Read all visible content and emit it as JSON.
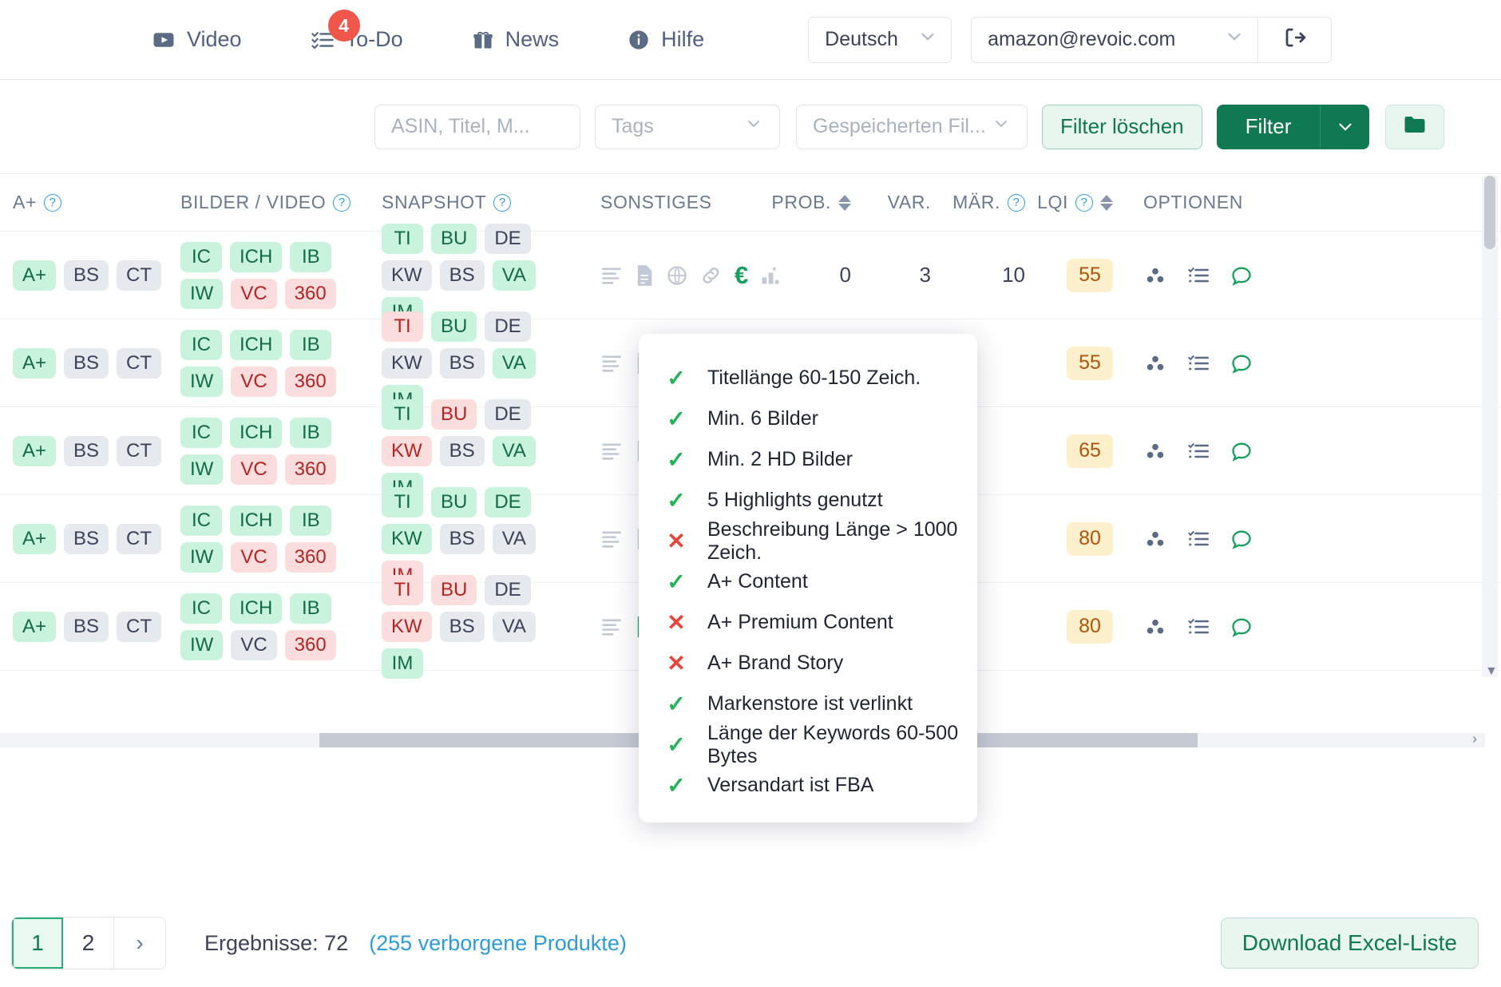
{
  "header": {
    "nav": [
      {
        "label": "Video",
        "icon": "video-icon"
      },
      {
        "label": "To-Do",
        "icon": "todo-list-icon",
        "badge": "4"
      },
      {
        "label": "News",
        "icon": "gift-icon"
      },
      {
        "label": "Hilfe",
        "icon": "info-icon"
      }
    ],
    "language": "Deutsch",
    "account": "amazon@revoic.com",
    "logout_icon": "logout-icon"
  },
  "toolbar": {
    "search_placeholder": "ASIN, Titel, M...",
    "search_value": "",
    "tags_placeholder": "Tags",
    "saved_filter_placeholder": "Gespeicherten Fil...",
    "clear_filter_label": "Filter löschen",
    "filter_label": "Filter",
    "folder_icon": "folder-icon"
  },
  "table": {
    "columns": [
      {
        "label": "A+",
        "help": true
      },
      {
        "label": "BILDER / VIDEO",
        "help": true
      },
      {
        "label": "SNAPSHOT",
        "help": true
      },
      {
        "label": "SONSTIGES",
        "help": false
      },
      {
        "label": "PROB.",
        "sort": true
      },
      {
        "label": "VAR.",
        "sort": false
      },
      {
        "label": "MÄR.",
        "help": true
      },
      {
        "label": "LQI",
        "help": true,
        "sort": true
      },
      {
        "label": "OPTIONEN",
        "help": false
      }
    ],
    "rows": [
      {
        "ap": [
          {
            "t": "A+",
            "s": "green"
          },
          {
            "t": "BS",
            "s": "grey"
          },
          {
            "t": "CT",
            "s": "grey"
          }
        ],
        "bilder": [
          {
            "t": "IC",
            "s": "green"
          },
          {
            "t": "ICH",
            "s": "green"
          },
          {
            "t": "IB",
            "s": "green"
          },
          {
            "t": "IW",
            "s": "green"
          },
          {
            "t": "VC",
            "s": "red"
          },
          {
            "t": "360",
            "s": "red"
          }
        ],
        "snapshot": [
          {
            "t": "TI",
            "s": "green"
          },
          {
            "t": "BU",
            "s": "green"
          },
          {
            "t": "DE",
            "s": "grey"
          },
          {
            "t": "KW",
            "s": "grey"
          },
          {
            "t": "BS",
            "s": "grey"
          },
          {
            "t": "VA",
            "s": "green"
          },
          {
            "t": "IM",
            "s": "green"
          }
        ],
        "sonstiges": [
          "bullets-icon",
          "document-icon",
          "globe-icon",
          "link-icon",
          "euro-icon",
          "chart-icon"
        ],
        "prob": "0",
        "var": "3",
        "maer": "10",
        "lqi": "55"
      },
      {
        "ap": [
          {
            "t": "A+",
            "s": "green"
          },
          {
            "t": "BS",
            "s": "grey"
          },
          {
            "t": "CT",
            "s": "grey"
          }
        ],
        "bilder": [
          {
            "t": "IC",
            "s": "green"
          },
          {
            "t": "ICH",
            "s": "green"
          },
          {
            "t": "IB",
            "s": "green"
          },
          {
            "t": "IW",
            "s": "green"
          },
          {
            "t": "VC",
            "s": "red"
          },
          {
            "t": "360",
            "s": "red"
          }
        ],
        "snapshot": [
          {
            "t": "TI",
            "s": "red"
          },
          {
            "t": "BU",
            "s": "green"
          },
          {
            "t": "DE",
            "s": "grey"
          },
          {
            "t": "KW",
            "s": "grey"
          },
          {
            "t": "BS",
            "s": "grey"
          },
          {
            "t": "VA",
            "s": "green"
          },
          {
            "t": "IM",
            "s": "green"
          }
        ],
        "sonstiges": [
          "bullets-icon",
          "document-icon"
        ],
        "prob": "",
        "var": "",
        "maer": "",
        "lqi": "55"
      },
      {
        "ap": [
          {
            "t": "A+",
            "s": "green"
          },
          {
            "t": "BS",
            "s": "grey"
          },
          {
            "t": "CT",
            "s": "grey"
          }
        ],
        "bilder": [
          {
            "t": "IC",
            "s": "green"
          },
          {
            "t": "ICH",
            "s": "green"
          },
          {
            "t": "IB",
            "s": "green"
          },
          {
            "t": "IW",
            "s": "green"
          },
          {
            "t": "VC",
            "s": "red"
          },
          {
            "t": "360",
            "s": "red"
          }
        ],
        "snapshot": [
          {
            "t": "TI",
            "s": "green"
          },
          {
            "t": "BU",
            "s": "red"
          },
          {
            "t": "DE",
            "s": "grey"
          },
          {
            "t": "KW",
            "s": "red"
          },
          {
            "t": "BS",
            "s": "grey"
          },
          {
            "t": "VA",
            "s": "green"
          },
          {
            "t": "IM",
            "s": "green"
          }
        ],
        "sonstiges": [
          "bullets-icon",
          "document-icon"
        ],
        "prob": "",
        "var": "",
        "maer": "",
        "lqi": "65"
      },
      {
        "ap": [
          {
            "t": "A+",
            "s": "green"
          },
          {
            "t": "BS",
            "s": "grey"
          },
          {
            "t": "CT",
            "s": "grey"
          }
        ],
        "bilder": [
          {
            "t": "IC",
            "s": "green"
          },
          {
            "t": "ICH",
            "s": "green"
          },
          {
            "t": "IB",
            "s": "green"
          },
          {
            "t": "IW",
            "s": "green"
          },
          {
            "t": "VC",
            "s": "red"
          },
          {
            "t": "360",
            "s": "red"
          }
        ],
        "snapshot": [
          {
            "t": "TI",
            "s": "green"
          },
          {
            "t": "BU",
            "s": "green"
          },
          {
            "t": "DE",
            "s": "green"
          },
          {
            "t": "KW",
            "s": "green"
          },
          {
            "t": "BS",
            "s": "grey"
          },
          {
            "t": "VA",
            "s": "grey"
          },
          {
            "t": "IM",
            "s": "red"
          }
        ],
        "sonstiges": [
          "bullets-icon",
          "document-icon"
        ],
        "prob": "",
        "var": "",
        "maer": "",
        "lqi": "80"
      },
      {
        "ap": [
          {
            "t": "A+",
            "s": "green"
          },
          {
            "t": "BS",
            "s": "grey"
          },
          {
            "t": "CT",
            "s": "grey"
          }
        ],
        "bilder": [
          {
            "t": "IC",
            "s": "green"
          },
          {
            "t": "ICH",
            "s": "green"
          },
          {
            "t": "IB",
            "s": "green"
          },
          {
            "t": "IW",
            "s": "green"
          },
          {
            "t": "VC",
            "s": "grey"
          },
          {
            "t": "360",
            "s": "red"
          }
        ],
        "snapshot": [
          {
            "t": "TI",
            "s": "red"
          },
          {
            "t": "BU",
            "s": "red"
          },
          {
            "t": "DE",
            "s": "grey"
          },
          {
            "t": "KW",
            "s": "red"
          },
          {
            "t": "BS",
            "s": "grey"
          },
          {
            "t": "VA",
            "s": "grey"
          },
          {
            "t": "IM",
            "s": "green"
          }
        ],
        "sonstiges": [
          "bullets-icon",
          "document-green-icon"
        ],
        "prob": "",
        "var": "",
        "maer": "",
        "lqi": "80"
      }
    ],
    "option_icons": [
      "group-icon",
      "checklist-icon",
      "comment-icon"
    ]
  },
  "popup": {
    "items": [
      {
        "status": "ok",
        "label": "Titellänge 60-150 Zeich."
      },
      {
        "status": "ok",
        "label": "Min. 6 Bilder"
      },
      {
        "status": "ok",
        "label": "Min. 2 HD Bilder"
      },
      {
        "status": "ok",
        "label": "5 Highlights genutzt"
      },
      {
        "status": "no",
        "label": "Beschreibung Länge > 1000 Zeich."
      },
      {
        "status": "ok",
        "label": "A+ Content"
      },
      {
        "status": "no",
        "label": "A+ Premium Content"
      },
      {
        "status": "no",
        "label": "A+ Brand Story"
      },
      {
        "status": "ok",
        "label": "Markenstore ist verlinkt"
      },
      {
        "status": "ok",
        "label": "Länge der Keywords 60-500 Bytes"
      },
      {
        "status": "ok",
        "label": "Versandart ist FBA"
      }
    ],
    "ok_glyph": "✓",
    "no_glyph": "✕"
  },
  "footer": {
    "pages": [
      "1",
      "2"
    ],
    "active_page": "1",
    "next_glyph": "›",
    "results_label": "Ergebnisse: 72",
    "hidden_products": "(255 verborgene Produkte)",
    "download_label": "Download Excel-Liste"
  },
  "colors": {
    "brand_green": "#0f7a52",
    "link_blue": "#2d9cdb",
    "badge_red": "#f0564a",
    "lqi_amber": "#fdf0cd"
  }
}
